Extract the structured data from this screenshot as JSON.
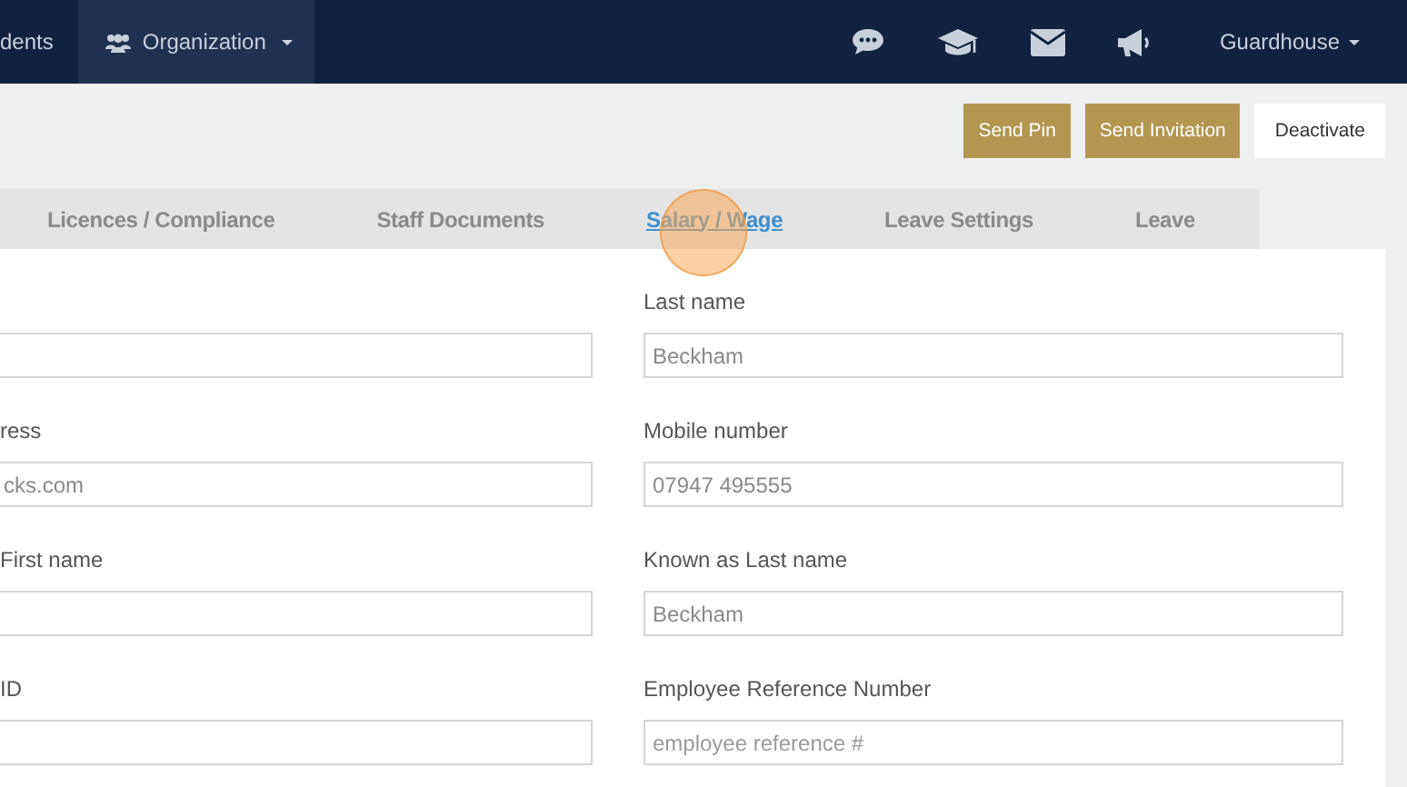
{
  "navbar": {
    "items": [
      {
        "label": "dents",
        "selected": false,
        "kind": "link"
      },
      {
        "label": "Organization",
        "selected": true,
        "kind": "dropdown"
      }
    ],
    "user": "Guardhouse"
  },
  "actions": [
    {
      "label": "Send Pin",
      "kind": "primary"
    },
    {
      "label": "Send Invitation",
      "kind": "primary"
    },
    {
      "label": "Deactivate",
      "kind": "plain"
    }
  ],
  "tabs": [
    {
      "label": "Licences / Compliance",
      "selected": false
    },
    {
      "label": "Staff Documents",
      "selected": false
    },
    {
      "label": "Salary / Wage",
      "selected": true
    },
    {
      "label": "Leave Settings",
      "selected": false
    },
    {
      "label": "Leave",
      "selected": false
    }
  ],
  "form": {
    "left": [
      {
        "kind": "text"
      },
      {
        "kind": "text",
        "label": "ress",
        "value": "cks.com"
      },
      {
        "kind": "text",
        "label": "First name"
      },
      {
        "kind": "text",
        "label": "ID"
      }
    ],
    "right": [
      {
        "label": "Last name",
        "value": "Beckham"
      },
      {
        "label": "Mobile number",
        "value": "07947 495555"
      },
      {
        "label": "Known as Last name",
        "value": "Beckham"
      },
      {
        "label": "Employee Reference Number",
        "placeholder": "employee reference #"
      }
    ]
  }
}
